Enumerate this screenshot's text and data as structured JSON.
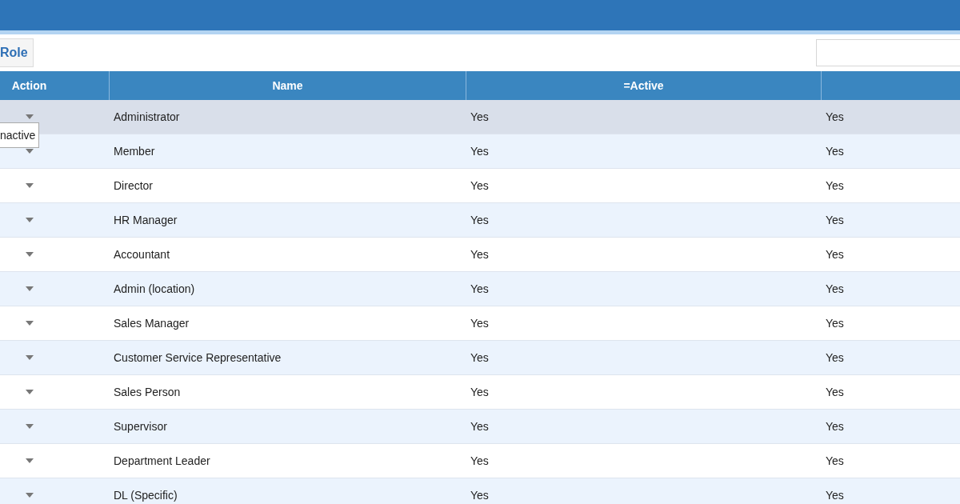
{
  "toolbar": {
    "button": "Role"
  },
  "table": {
    "columns": [
      "Action",
      "Name",
      "=Active"
    ],
    "rows": [
      {
        "name": "Administrator",
        "active": "Yes",
        "column_4": "Yes",
        "highlighted": true
      },
      {
        "name": "Member",
        "active": "Yes",
        "column_4": "Yes",
        "highlighted": false
      },
      {
        "name": "Director",
        "active": "Yes",
        "column_4": "Yes",
        "highlighted": false
      },
      {
        "name": "HR Manager",
        "active": "Yes",
        "column_4": "Yes",
        "highlighted": false
      },
      {
        "name": "Accountant",
        "active": "Yes",
        "column_4": "Yes",
        "highlighted": false
      },
      {
        "name": "Admin (location)",
        "active": "Yes",
        "column_4": "Yes",
        "highlighted": false
      },
      {
        "name": "Sales Manager",
        "active": "Yes",
        "column_4": "Yes",
        "highlighted": false
      },
      {
        "name": "Customer Service Representative",
        "active": "Yes",
        "column_4": "Yes",
        "highlighted": false
      },
      {
        "name": "Sales Person",
        "active": "Yes",
        "column_4": "Yes",
        "highlighted": false
      },
      {
        "name": "Supervisor",
        "active": "Yes",
        "column_4": "Yes",
        "highlighted": false
      },
      {
        "name": "Department Leader",
        "active": "Yes",
        "column_4": "Yes",
        "highlighted": false
      },
      {
        "name": "DL (Specific)",
        "active": "Yes",
        "column_4": "Yes",
        "highlighted": false
      }
    ]
  },
  "tooltip": "nactive"
}
